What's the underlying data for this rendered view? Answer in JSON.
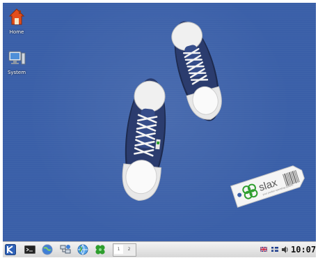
{
  "desktop": {
    "icons": [
      {
        "label": "Home",
        "icon": "home-icon"
      },
      {
        "label": "System",
        "icon": "computer-icon"
      }
    ],
    "wallpaper": {
      "tag_brand": "slax",
      "tag_subtitle": "your pocket operating system"
    }
  },
  "taskbar": {
    "launchers": [
      {
        "icon": "kde-menu-icon"
      },
      {
        "icon": "terminal-icon"
      },
      {
        "icon": "browser-globe-icon"
      },
      {
        "icon": "network-computers-icon"
      },
      {
        "icon": "internet-globe-icon"
      },
      {
        "icon": "clover-icon"
      }
    ],
    "pager": [
      "1",
      "2"
    ],
    "tray": [
      "keyboard-layout-flag-icon",
      "language-flag-icon",
      "volume-icon"
    ],
    "clock": "10:07"
  },
  "colors": {
    "desktop_bg": "#3a5fa8",
    "taskbar_bg": "#e2e2e2",
    "clover_green": "#2e9e2e"
  }
}
